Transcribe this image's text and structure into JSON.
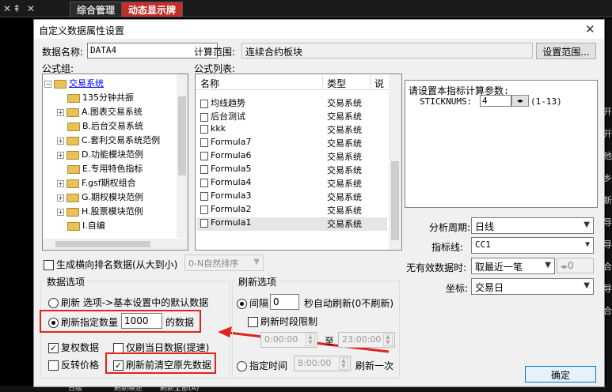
{
  "topbar": {
    "icon_x": "✕",
    "icon_pin": "⇞",
    "icon_close": "✕",
    "tab1": "综合管理",
    "tab2": "动态显示牌"
  },
  "dialog": {
    "title": "自定义数据属性设置",
    "close": "✕",
    "data_name_label": "数据名称:",
    "data_name_value": "DATA4",
    "calc_range_label": "计算范围:",
    "calc_range_value": "连续合约板块",
    "set_range_button": "设置范围...",
    "formula_group_label": "公式组:",
    "formula_list_label": "公式列表:"
  },
  "tree": {
    "root": "交易系统",
    "items": [
      "135分钟共振",
      "A.图表交易系统",
      "B.后台交易系统",
      "C.套利交易系统范例",
      "D.功能模块范例",
      "E.专用特色指标",
      "F.gsf期权组合",
      "G.期权模块范例",
      "H.股票模块范例",
      "I.自编"
    ]
  },
  "formula_list": {
    "columns": [
      "名称",
      "类型",
      "说"
    ],
    "rows": [
      {
        "name": "均线趋势",
        "type": "交易系统"
      },
      {
        "name": "后台测试",
        "type": "交易系统"
      },
      {
        "name": "kkk",
        "type": "交易系统"
      },
      {
        "name": "Formula7",
        "type": "交易系统"
      },
      {
        "name": "Formula6",
        "type": "交易系统"
      },
      {
        "name": "Formula5",
        "type": "交易系统"
      },
      {
        "name": "Formula4",
        "type": "交易系统"
      },
      {
        "name": "Formula3",
        "type": "交易系统"
      },
      {
        "name": "Formula2",
        "type": "交易系统"
      },
      {
        "name": "Formula1",
        "type": "交易系统"
      }
    ]
  },
  "params": {
    "prompt": "请设置本指标计算参数:",
    "param_name": "STICKNUMS:",
    "param_value": "4",
    "param_range": "(1-13)"
  },
  "settings": {
    "period_label": "分析周期:",
    "period_value": "日线",
    "indicator_label": "指标线:",
    "indicator_value": "CC1",
    "invalid_label": "无有效数据时:",
    "invalid_value": "取最近一笔",
    "invalid_num": "0",
    "coord_label": "坐标:",
    "coord_value": "交易日"
  },
  "rank": {
    "label": "生成横向排名数据(从大到小)",
    "sort_value": "0-N自然排序"
  },
  "data_options": {
    "legend": "数据选项",
    "refresh_basic": "刷新 选项->基本设置中的默认数据",
    "refresh_specified": "刷新指定数量",
    "count": "1000",
    "of_data": "的数据",
    "adjust_price": "复权数据",
    "today_only": "仅刷当日数据(提速)",
    "reverse_price": "反转价格",
    "clear_before": "刷新前清空原先数据"
  },
  "refresh_options": {
    "legend": "刷新选项",
    "interval_label": "间隔",
    "interval_value": "0",
    "interval_suffix": "秒自动刷新(0不刷新)",
    "period_limit": "刷新时段限制",
    "time_start": "0:00:00",
    "to": "至",
    "time_end": "23:00:00",
    "fixed_time_label": "指定时间",
    "fixed_time_value": "8:00:00",
    "once": "刷新一次"
  },
  "ok_button": "确定",
  "right_chars": [
    "开",
    "开",
    "他",
    "乡",
    "新",
    "导",
    "导",
    "合",
    "导",
    "合"
  ],
  "bottom": {
    "b1": "日级",
    "b2": "刷新映述",
    "b3": "刷新全部(A)"
  },
  "colors": {
    "tab_active": "#c0302a",
    "highlight": "#e0241d",
    "link": "#0000ff"
  }
}
